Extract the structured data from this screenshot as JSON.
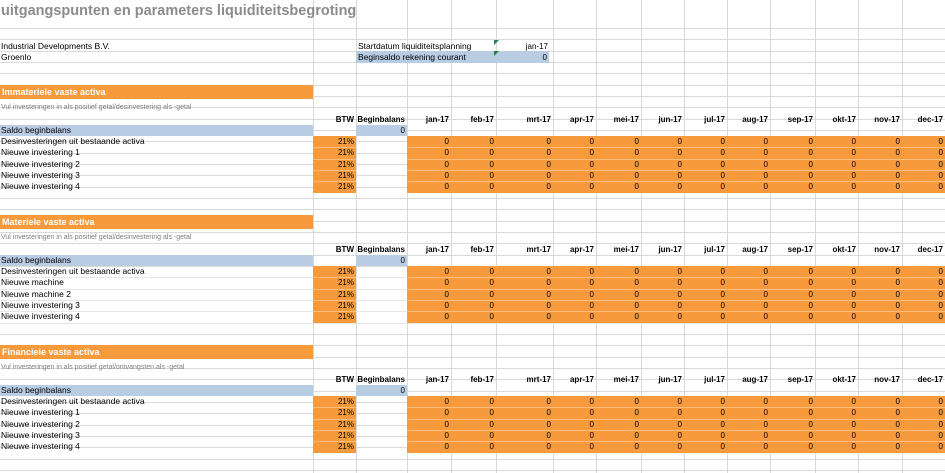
{
  "title": "uitgangspunten en parameters liquiditeitsbegroting",
  "company": {
    "name": "Industrial Developments B.V.",
    "city": "Groenlo"
  },
  "params": {
    "start_label": "Startdatum liquiditeitsplanning",
    "start_value": "jan-17",
    "saldo_label": "Beginsaldo rekening courant",
    "saldo_value": "0"
  },
  "headers": {
    "btw": "BTW",
    "beginbalans": "Beginbalans",
    "months": [
      "jan-17",
      "feb-17",
      "mrt-17",
      "apr-17",
      "mei-17",
      "jun-17",
      "jul-17",
      "aug-17",
      "sep-17",
      "okt-17",
      "nov-17",
      "dec-17"
    ]
  },
  "sections": [
    {
      "title": "Immateriele vaste activa",
      "note": "Vul investeringen in als positief getal/desinvestering als -getal",
      "saldo_label": "Saldo beginbalans",
      "saldo_value": "0",
      "rows": [
        {
          "label": "Desinvesteringen uit bestaande activa",
          "btw": "21%",
          "values": [
            "0",
            "0",
            "0",
            "0",
            "0",
            "0",
            "0",
            "0",
            "0",
            "0",
            "0",
            "0"
          ]
        },
        {
          "label": "Nieuwe investering 1",
          "btw": "21%",
          "values": [
            "0",
            "0",
            "0",
            "0",
            "0",
            "0",
            "0",
            "0",
            "0",
            "0",
            "0",
            "0"
          ]
        },
        {
          "label": "Nieuwe investering 2",
          "btw": "21%",
          "values": [
            "0",
            "0",
            "0",
            "0",
            "0",
            "0",
            "0",
            "0",
            "0",
            "0",
            "0",
            "0"
          ]
        },
        {
          "label": "Nieuwe investering 3",
          "btw": "21%",
          "values": [
            "0",
            "0",
            "0",
            "0",
            "0",
            "0",
            "0",
            "0",
            "0",
            "0",
            "0",
            "0"
          ]
        },
        {
          "label": "Nieuwe investering 4",
          "btw": "21%",
          "values": [
            "0",
            "0",
            "0",
            "0",
            "0",
            "0",
            "0",
            "0",
            "0",
            "0",
            "0",
            "0"
          ]
        }
      ]
    },
    {
      "title": "Materiele vaste activa",
      "note": "Vul investeringen in als positief getal/desinvestering als -getal",
      "saldo_label": "Saldo beginbalans",
      "saldo_value": "0",
      "rows": [
        {
          "label": "Desinvesteringen uit bestaande activa",
          "btw": "21%",
          "values": [
            "0",
            "0",
            "0",
            "0",
            "0",
            "0",
            "0",
            "0",
            "0",
            "0",
            "0",
            "0"
          ]
        },
        {
          "label": "Nieuwe machine",
          "btw": "21%",
          "values": [
            "0",
            "0",
            "0",
            "0",
            "0",
            "0",
            "0",
            "0",
            "0",
            "0",
            "0",
            "0"
          ]
        },
        {
          "label": "Nieuwe machine 2",
          "btw": "21%",
          "values": [
            "0",
            "0",
            "0",
            "0",
            "0",
            "0",
            "0",
            "0",
            "0",
            "0",
            "0",
            "0"
          ]
        },
        {
          "label": "Nieuwe investering 3",
          "btw": "21%",
          "values": [
            "0",
            "0",
            "0",
            "0",
            "0",
            "0",
            "0",
            "0",
            "0",
            "0",
            "0",
            "0"
          ]
        },
        {
          "label": "Nieuwe investering 4",
          "btw": "21%",
          "values": [
            "0",
            "0",
            "0",
            "0",
            "0",
            "0",
            "0",
            "0",
            "0",
            "0",
            "0",
            "0"
          ]
        }
      ]
    },
    {
      "title": "Financiele vaste activa",
      "note": "Vul investeringen in als positief getal/ontvangsten als -getal",
      "saldo_label": "Saldo beginbalans",
      "saldo_value": "0",
      "rows": [
        {
          "label": "Desinvesteringen uit bestaande activa",
          "btw": "21%",
          "values": [
            "0",
            "0",
            "0",
            "0",
            "0",
            "0",
            "0",
            "0",
            "0",
            "0",
            "0",
            "0"
          ]
        },
        {
          "label": "Nieuwe investering 1",
          "btw": "21%",
          "values": [
            "0",
            "0",
            "0",
            "0",
            "0",
            "0",
            "0",
            "0",
            "0",
            "0",
            "0",
            "0"
          ]
        },
        {
          "label": "Nieuwe investering 2",
          "btw": "21%",
          "values": [
            "0",
            "0",
            "0",
            "0",
            "0",
            "0",
            "0",
            "0",
            "0",
            "0",
            "0",
            "0"
          ]
        },
        {
          "label": "Nieuwe investering 3",
          "btw": "21%",
          "values": [
            "0",
            "0",
            "0",
            "0",
            "0",
            "0",
            "0",
            "0",
            "0",
            "0",
            "0",
            "0"
          ]
        },
        {
          "label": "Nieuwe investering 4",
          "btw": "21%",
          "values": [
            "0",
            "0",
            "0",
            "0",
            "0",
            "0",
            "0",
            "0",
            "0",
            "0",
            "0",
            "0"
          ]
        }
      ]
    }
  ],
  "colors": {
    "input_orange": "#f79a3c",
    "input_blue": "#b8cce4",
    "gridline": "#d9d9d9",
    "title_gray": "#8c8c8c"
  }
}
